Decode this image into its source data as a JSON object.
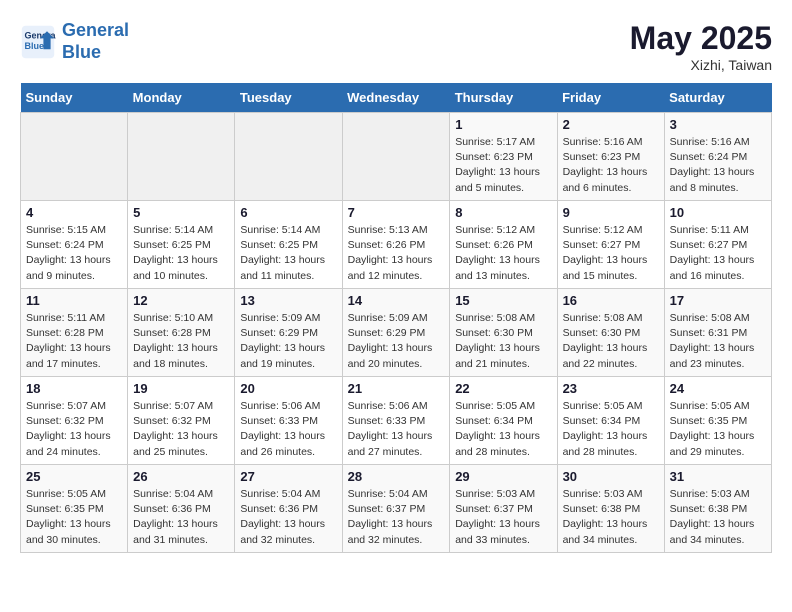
{
  "header": {
    "logo_line1": "General",
    "logo_line2": "Blue",
    "month_year": "May 2025",
    "location": "Xizhi, Taiwan"
  },
  "days_of_week": [
    "Sunday",
    "Monday",
    "Tuesday",
    "Wednesday",
    "Thursday",
    "Friday",
    "Saturday"
  ],
  "weeks": [
    [
      {
        "day": "",
        "info": ""
      },
      {
        "day": "",
        "info": ""
      },
      {
        "day": "",
        "info": ""
      },
      {
        "day": "",
        "info": ""
      },
      {
        "day": "1",
        "info": "Sunrise: 5:17 AM\nSunset: 6:23 PM\nDaylight: 13 hours\nand 5 minutes."
      },
      {
        "day": "2",
        "info": "Sunrise: 5:16 AM\nSunset: 6:23 PM\nDaylight: 13 hours\nand 6 minutes."
      },
      {
        "day": "3",
        "info": "Sunrise: 5:16 AM\nSunset: 6:24 PM\nDaylight: 13 hours\nand 8 minutes."
      }
    ],
    [
      {
        "day": "4",
        "info": "Sunrise: 5:15 AM\nSunset: 6:24 PM\nDaylight: 13 hours\nand 9 minutes."
      },
      {
        "day": "5",
        "info": "Sunrise: 5:14 AM\nSunset: 6:25 PM\nDaylight: 13 hours\nand 10 minutes."
      },
      {
        "day": "6",
        "info": "Sunrise: 5:14 AM\nSunset: 6:25 PM\nDaylight: 13 hours\nand 11 minutes."
      },
      {
        "day": "7",
        "info": "Sunrise: 5:13 AM\nSunset: 6:26 PM\nDaylight: 13 hours\nand 12 minutes."
      },
      {
        "day": "8",
        "info": "Sunrise: 5:12 AM\nSunset: 6:26 PM\nDaylight: 13 hours\nand 13 minutes."
      },
      {
        "day": "9",
        "info": "Sunrise: 5:12 AM\nSunset: 6:27 PM\nDaylight: 13 hours\nand 15 minutes."
      },
      {
        "day": "10",
        "info": "Sunrise: 5:11 AM\nSunset: 6:27 PM\nDaylight: 13 hours\nand 16 minutes."
      }
    ],
    [
      {
        "day": "11",
        "info": "Sunrise: 5:11 AM\nSunset: 6:28 PM\nDaylight: 13 hours\nand 17 minutes."
      },
      {
        "day": "12",
        "info": "Sunrise: 5:10 AM\nSunset: 6:28 PM\nDaylight: 13 hours\nand 18 minutes."
      },
      {
        "day": "13",
        "info": "Sunrise: 5:09 AM\nSunset: 6:29 PM\nDaylight: 13 hours\nand 19 minutes."
      },
      {
        "day": "14",
        "info": "Sunrise: 5:09 AM\nSunset: 6:29 PM\nDaylight: 13 hours\nand 20 minutes."
      },
      {
        "day": "15",
        "info": "Sunrise: 5:08 AM\nSunset: 6:30 PM\nDaylight: 13 hours\nand 21 minutes."
      },
      {
        "day": "16",
        "info": "Sunrise: 5:08 AM\nSunset: 6:30 PM\nDaylight: 13 hours\nand 22 minutes."
      },
      {
        "day": "17",
        "info": "Sunrise: 5:08 AM\nSunset: 6:31 PM\nDaylight: 13 hours\nand 23 minutes."
      }
    ],
    [
      {
        "day": "18",
        "info": "Sunrise: 5:07 AM\nSunset: 6:32 PM\nDaylight: 13 hours\nand 24 minutes."
      },
      {
        "day": "19",
        "info": "Sunrise: 5:07 AM\nSunset: 6:32 PM\nDaylight: 13 hours\nand 25 minutes."
      },
      {
        "day": "20",
        "info": "Sunrise: 5:06 AM\nSunset: 6:33 PM\nDaylight: 13 hours\nand 26 minutes."
      },
      {
        "day": "21",
        "info": "Sunrise: 5:06 AM\nSunset: 6:33 PM\nDaylight: 13 hours\nand 27 minutes."
      },
      {
        "day": "22",
        "info": "Sunrise: 5:05 AM\nSunset: 6:34 PM\nDaylight: 13 hours\nand 28 minutes."
      },
      {
        "day": "23",
        "info": "Sunrise: 5:05 AM\nSunset: 6:34 PM\nDaylight: 13 hours\nand 28 minutes."
      },
      {
        "day": "24",
        "info": "Sunrise: 5:05 AM\nSunset: 6:35 PM\nDaylight: 13 hours\nand 29 minutes."
      }
    ],
    [
      {
        "day": "25",
        "info": "Sunrise: 5:05 AM\nSunset: 6:35 PM\nDaylight: 13 hours\nand 30 minutes."
      },
      {
        "day": "26",
        "info": "Sunrise: 5:04 AM\nSunset: 6:36 PM\nDaylight: 13 hours\nand 31 minutes."
      },
      {
        "day": "27",
        "info": "Sunrise: 5:04 AM\nSunset: 6:36 PM\nDaylight: 13 hours\nand 32 minutes."
      },
      {
        "day": "28",
        "info": "Sunrise: 5:04 AM\nSunset: 6:37 PM\nDaylight: 13 hours\nand 32 minutes."
      },
      {
        "day": "29",
        "info": "Sunrise: 5:03 AM\nSunset: 6:37 PM\nDaylight: 13 hours\nand 33 minutes."
      },
      {
        "day": "30",
        "info": "Sunrise: 5:03 AM\nSunset: 6:38 PM\nDaylight: 13 hours\nand 34 minutes."
      },
      {
        "day": "31",
        "info": "Sunrise: 5:03 AM\nSunset: 6:38 PM\nDaylight: 13 hours\nand 34 minutes."
      }
    ]
  ]
}
